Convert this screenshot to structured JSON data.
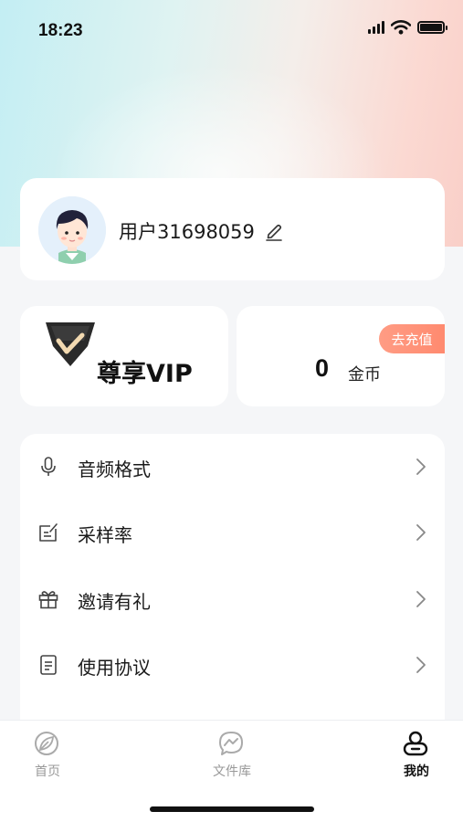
{
  "status_bar": {
    "time": "18:23"
  },
  "profile": {
    "username": "用户31698059"
  },
  "vip": {
    "label": "尊享VIP"
  },
  "coins": {
    "value": "0",
    "unit_label": "金币",
    "recharge_label": "去充值"
  },
  "menu": {
    "items": [
      {
        "label": "音频格式",
        "icon": "microphone-icon"
      },
      {
        "label": "采样率",
        "icon": "edit-document-icon"
      },
      {
        "label": "邀请有礼",
        "icon": "gift-icon"
      },
      {
        "label": "使用协议",
        "icon": "document-icon"
      }
    ]
  },
  "tab_bar": {
    "tabs": [
      {
        "label": "首页",
        "icon": "home-leaf-icon",
        "active": false
      },
      {
        "label": "文件库",
        "icon": "messenger-icon",
        "active": false
      },
      {
        "label": "我的",
        "icon": "profile-icon",
        "active": true
      }
    ]
  },
  "colors": {
    "accent": "#ff8f73",
    "text": "#1a1a1a",
    "muted": "#999999"
  }
}
